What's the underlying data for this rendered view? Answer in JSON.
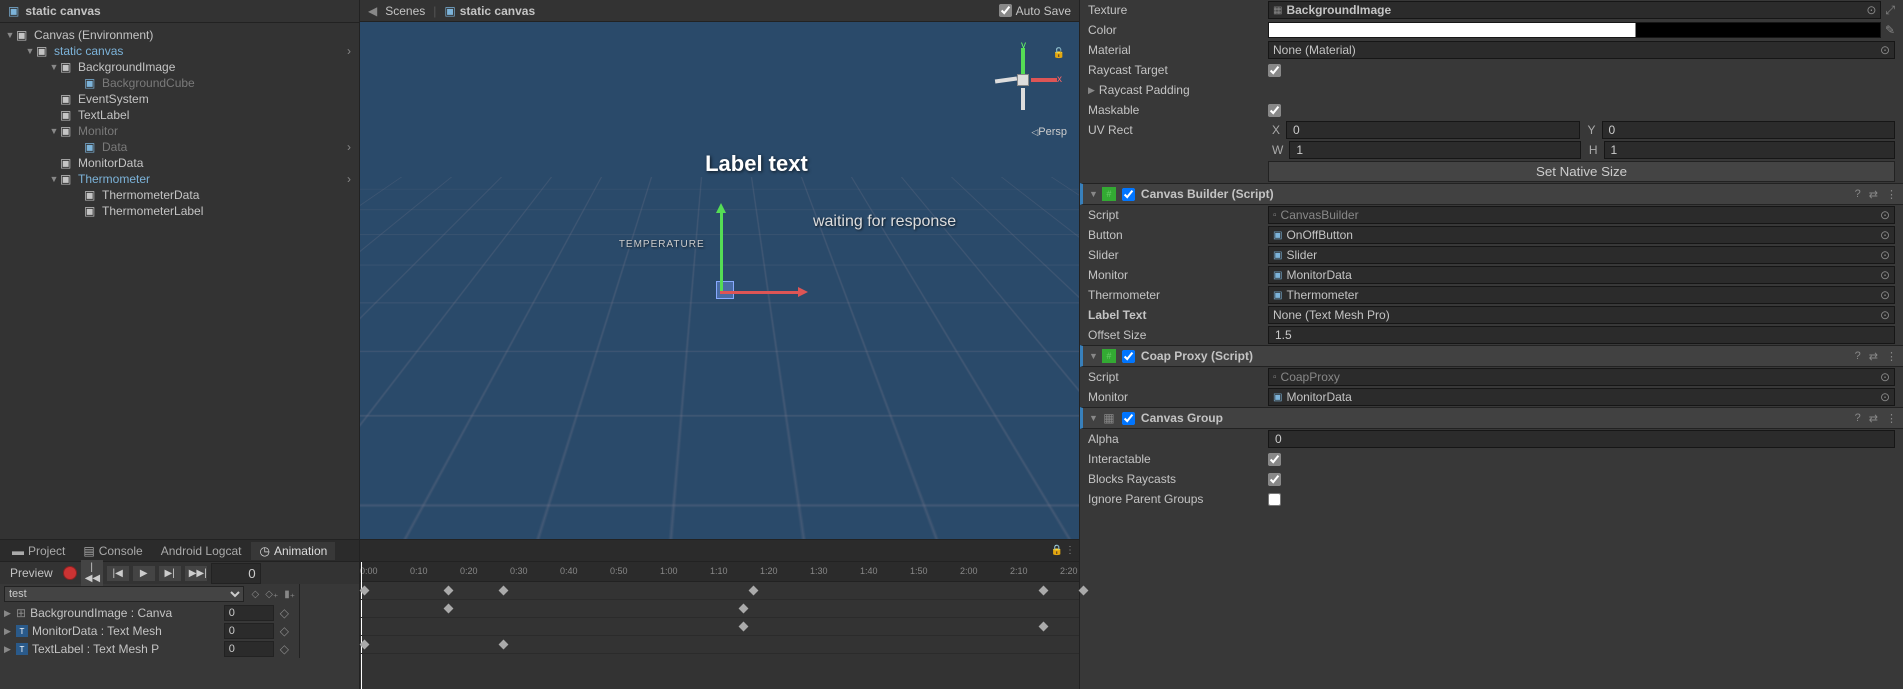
{
  "hierarchy": {
    "title": "static canvas",
    "root": "Canvas (Environment)",
    "items": [
      {
        "label": "static canvas",
        "indent": 2,
        "toggle": "▼",
        "blue": true
      },
      {
        "label": "BackgroundImage",
        "indent": 4,
        "toggle": "▼"
      },
      {
        "label": "BackgroundCube",
        "indent": 6,
        "dim": true,
        "blueIcon": true
      },
      {
        "label": "EventSystem",
        "indent": 4
      },
      {
        "label": "TextLabel",
        "indent": 4
      },
      {
        "label": "Monitor",
        "indent": 4,
        "toggle": "▼",
        "dim": true
      },
      {
        "label": "Data",
        "indent": 6,
        "dim": true,
        "labelBlue": true,
        "blueIcon": true
      },
      {
        "label": "MonitorData",
        "indent": 4
      },
      {
        "label": "Thermometer",
        "indent": 4,
        "toggle": "▼",
        "labelBlue": true
      },
      {
        "label": "ThermometerData",
        "indent": 6
      },
      {
        "label": "ThermometerLabel",
        "indent": 6
      }
    ],
    "chevronIndices": [
      0,
      6,
      8
    ]
  },
  "scene": {
    "tab1": "Scenes",
    "tab2": "static canvas",
    "autoSave": "Auto Save",
    "labelText": "Label text",
    "waiting": "waiting for response",
    "temperature": "TEMPERATURE",
    "persp": "Persp"
  },
  "bottomTabs": {
    "project": "Project",
    "console": "Console",
    "logcat": "Android Logcat",
    "animation": "Animation"
  },
  "animation": {
    "preview": "Preview",
    "frame": "0",
    "clip": "test",
    "props": [
      {
        "label": "BackgroundImage : Canva",
        "value": "0"
      },
      {
        "label": "MonitorData : Text Mesh",
        "value": "0",
        "icon": "T"
      },
      {
        "label": "TextLabel : Text Mesh P",
        "value": "0",
        "icon": "T"
      }
    ],
    "ticks": [
      "0:00",
      "0:10",
      "0:20",
      "0:30",
      "0:40",
      "0:50",
      "1:00",
      "1:10",
      "1:20",
      "1:30",
      "1:40",
      "1:50",
      "2:00",
      "2:10",
      "2:20"
    ]
  },
  "inspector": {
    "texture": {
      "label": "Texture",
      "value": "BackgroundImage"
    },
    "color": "Color",
    "material": {
      "label": "Material",
      "value": "None (Material)"
    },
    "raycastTarget": "Raycast Target",
    "raycastPadding": "Raycast Padding",
    "maskable": "Maskable",
    "uvRect": {
      "label": "UV Rect",
      "x": "0",
      "y": "0",
      "w": "1",
      "h": "1"
    },
    "setNative": "Set Native Size",
    "canvasBuilder": {
      "title": "Canvas Builder (Script)",
      "script": {
        "label": "Script",
        "value": "CanvasBuilder"
      },
      "button": {
        "label": "Button",
        "value": "OnOffButton"
      },
      "slider": {
        "label": "Slider",
        "value": "Slider"
      },
      "monitor": {
        "label": "Monitor",
        "value": "MonitorData"
      },
      "thermometer": {
        "label": "Thermometer",
        "value": "Thermometer"
      },
      "labelText": {
        "label": "Label Text",
        "value": "None (Text Mesh Pro)"
      },
      "offsetSize": {
        "label": "Offset Size",
        "value": "1.5"
      }
    },
    "coapProxy": {
      "title": "Coap Proxy (Script)",
      "script": {
        "label": "Script",
        "value": "CoapProxy"
      },
      "monitor": {
        "label": "Monitor",
        "value": "MonitorData"
      }
    },
    "canvasGroup": {
      "title": "Canvas Group",
      "alpha": {
        "label": "Alpha",
        "value": "0"
      },
      "interactable": "Interactable",
      "blocksRaycasts": "Blocks Raycasts",
      "ignoreParent": "Ignore Parent Groups"
    }
  }
}
